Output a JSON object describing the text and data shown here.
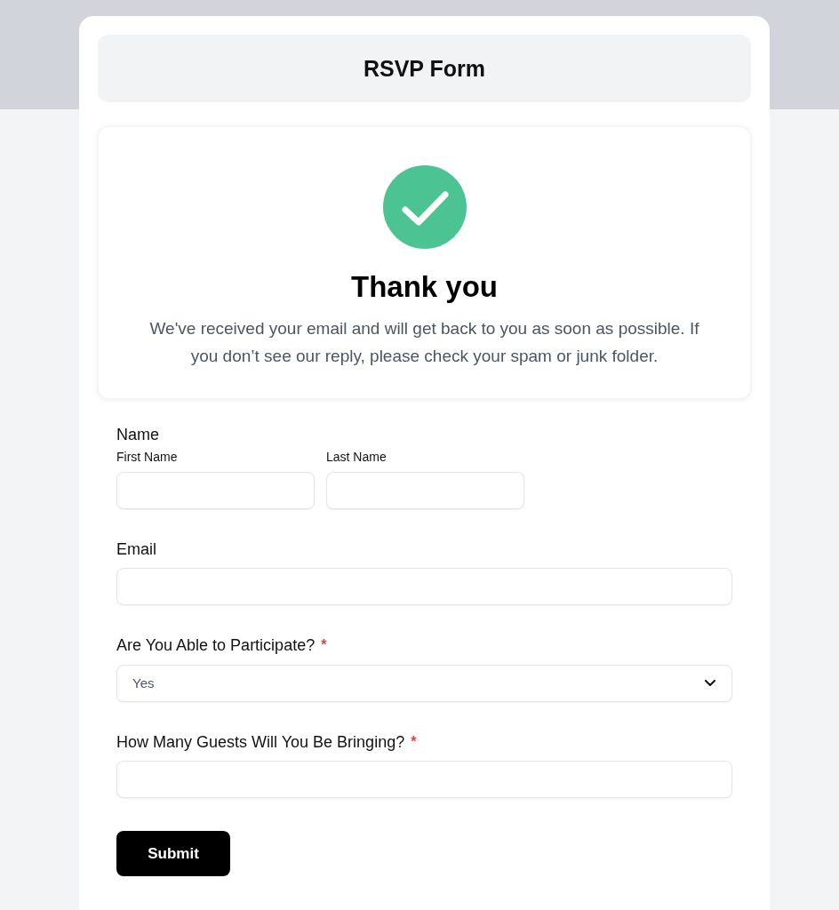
{
  "header": {
    "title": "RSVP Form"
  },
  "confirmation": {
    "title": "Thank you",
    "message": "We've received your email and will get back to you as soon as possible. If you don’t see our reply, please check your spam or junk folder."
  },
  "form": {
    "required_mark": "*",
    "fields": [
      {
        "kind": "name",
        "label": "Name",
        "required": false,
        "parts": [
          {
            "label": "First Name"
          },
          {
            "label": "Last Name"
          }
        ]
      },
      {
        "kind": "text",
        "label": "Email",
        "required": false
      },
      {
        "kind": "select",
        "label": "Are You Able to Participate?",
        "required": true,
        "value": "Yes"
      },
      {
        "kind": "text",
        "label": "How Many Guests Will You Be Bringing?",
        "required": true
      }
    ],
    "submit": {
      "label": "Submit"
    }
  }
}
